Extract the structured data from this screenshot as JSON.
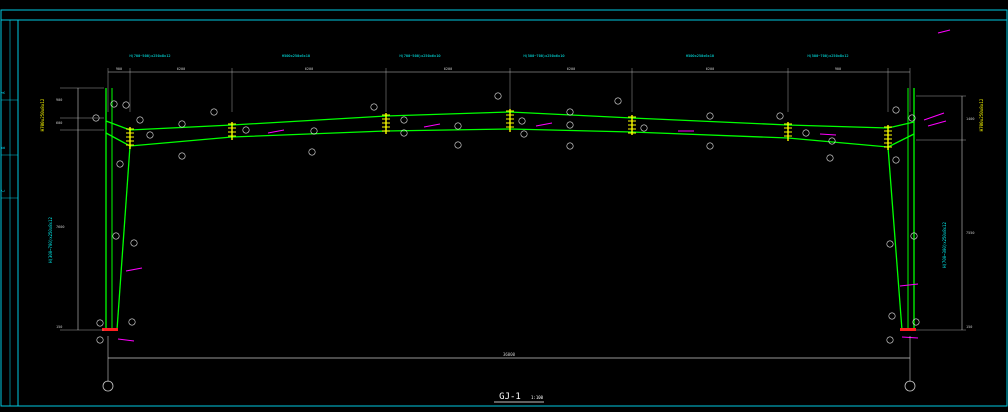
{
  "drawing": {
    "title": "GJ-1",
    "scale_note": "1:100",
    "colors": {
      "frame": "#00ff00",
      "border": "#00c8e0",
      "dims": "#c8c8c8",
      "bolts": "#ffff00",
      "callouts": "#ff00ff",
      "plates": "#ff2020",
      "labels_cyan": "#00ffff"
    },
    "top_section_labels": [
      "H(700~500)x250x8x12",
      "H500x250x6x10",
      "H(700~500)x250x6x10",
      "H(500~700)x250x6x10",
      "H500x250x6x10",
      "H(500~700)x250x8x12"
    ],
    "top_dims": [
      "900",
      "6200",
      "6200",
      "6200",
      "6200",
      "6200",
      "900"
    ],
    "left_column_label": "H(300~700)x250x8x12",
    "right_column_label": "H(700~300)x250x8x12",
    "left_top_label": "H700x250x8x12",
    "right_top_label": "H700x250x8x12",
    "left_dims": [
      "900",
      "600",
      "7600",
      "150"
    ],
    "right_dims": [
      "1400",
      "7550",
      "150"
    ],
    "overall_span": "36000",
    "side_marks": [
      "A",
      "B",
      "C"
    ]
  }
}
